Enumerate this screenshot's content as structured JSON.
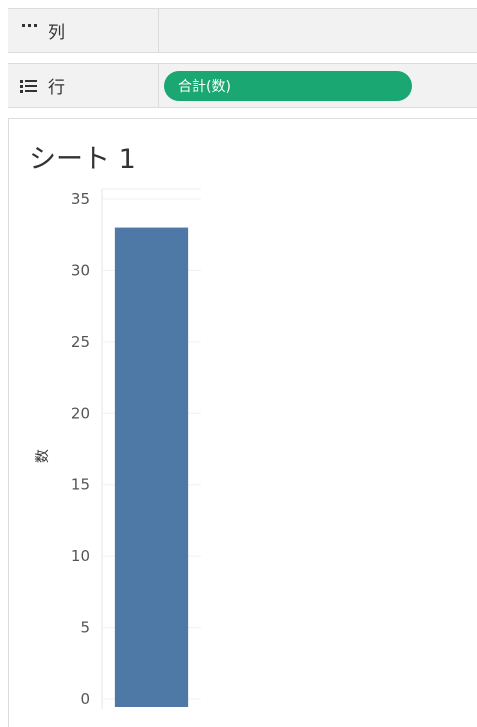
{
  "columns_shelf": {
    "label": "列",
    "icon": "columns-icon"
  },
  "rows_shelf": {
    "label": "行",
    "icon": "rows-list-icon",
    "pill": "合計(数)"
  },
  "sheet": {
    "title": "シート 1"
  },
  "colors": {
    "pill": "#1aa772",
    "bar": "#4e79a7"
  },
  "chart_data": {
    "type": "bar",
    "categories": [
      ""
    ],
    "values": [
      33
    ],
    "ylabel": "数",
    "xlabel": "",
    "ylim": [
      0,
      35
    ],
    "yticks": [
      0,
      5,
      10,
      15,
      20,
      25,
      30,
      35
    ],
    "grid": true
  }
}
